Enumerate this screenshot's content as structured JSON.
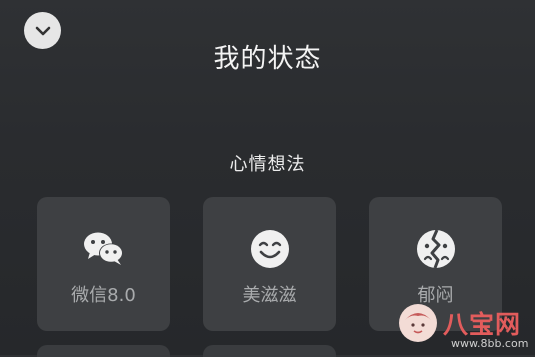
{
  "header": {
    "title": "我的状态",
    "collapse_icon": "chevron-down-icon"
  },
  "section": {
    "title": "心情想法"
  },
  "cards": [
    {
      "label": "微信8.0",
      "icon": "wechat-icon"
    },
    {
      "label": "美滋滋",
      "icon": "smile-icon"
    },
    {
      "label": "郁闷",
      "icon": "broken-heart-face-icon"
    }
  ],
  "watermark": {
    "text": "八宝网",
    "url": "www.8bb.com"
  },
  "colors": {
    "background": "#2b2d30",
    "card": "#3e4043",
    "title": "#f4f4f4",
    "label": "#a9abad",
    "icon": "#f0f0f0",
    "watermark": "#e25c5c"
  }
}
